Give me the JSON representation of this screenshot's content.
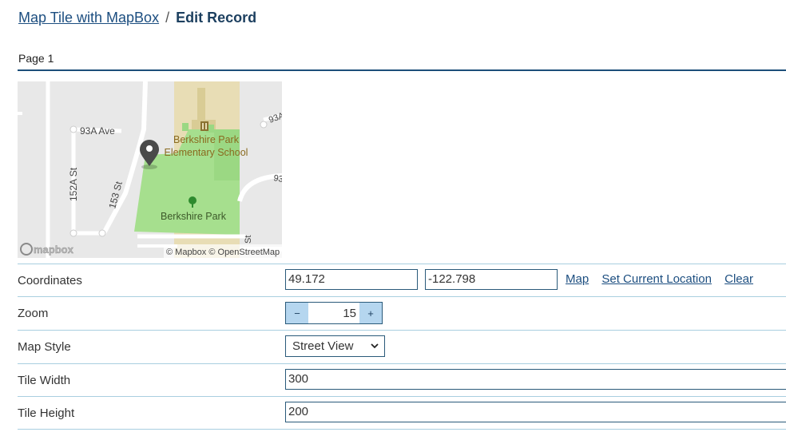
{
  "breadcrumb": {
    "parent": "Map Tile with MapBox",
    "separator": "/",
    "current": "Edit Record"
  },
  "page_tab": "Page 1",
  "map": {
    "labels": {
      "ave": "93A Ave",
      "st152": "152A St",
      "st153": "153 St",
      "school_1": "Berkshire Park",
      "school_2": "Elementary School",
      "park": "Berkshire Park",
      "edge_93a": "93A",
      "edge_93": "93",
      "edge_st": "St"
    },
    "logo": "mapbox",
    "attribution": "© Mapbox © OpenStreetMap",
    "colors": {
      "land": "#e8e8e8",
      "park": "#a6df8e",
      "school": "#e8ddb5",
      "road": "#ffffff",
      "pin": "#4a4a4a"
    }
  },
  "form": {
    "coordinates": {
      "label": "Coordinates",
      "lat": "49.172",
      "lng": "-122.798",
      "links": {
        "map": "Map",
        "set_location": "Set Current Location",
        "clear": "Clear"
      }
    },
    "zoom": {
      "label": "Zoom",
      "value": "15",
      "minus": "−",
      "plus": "+"
    },
    "map_style": {
      "label": "Map Style",
      "value": "Street View"
    },
    "tile_width": {
      "label": "Tile Width",
      "value": "300"
    },
    "tile_height": {
      "label": "Tile Height",
      "value": "200"
    }
  }
}
